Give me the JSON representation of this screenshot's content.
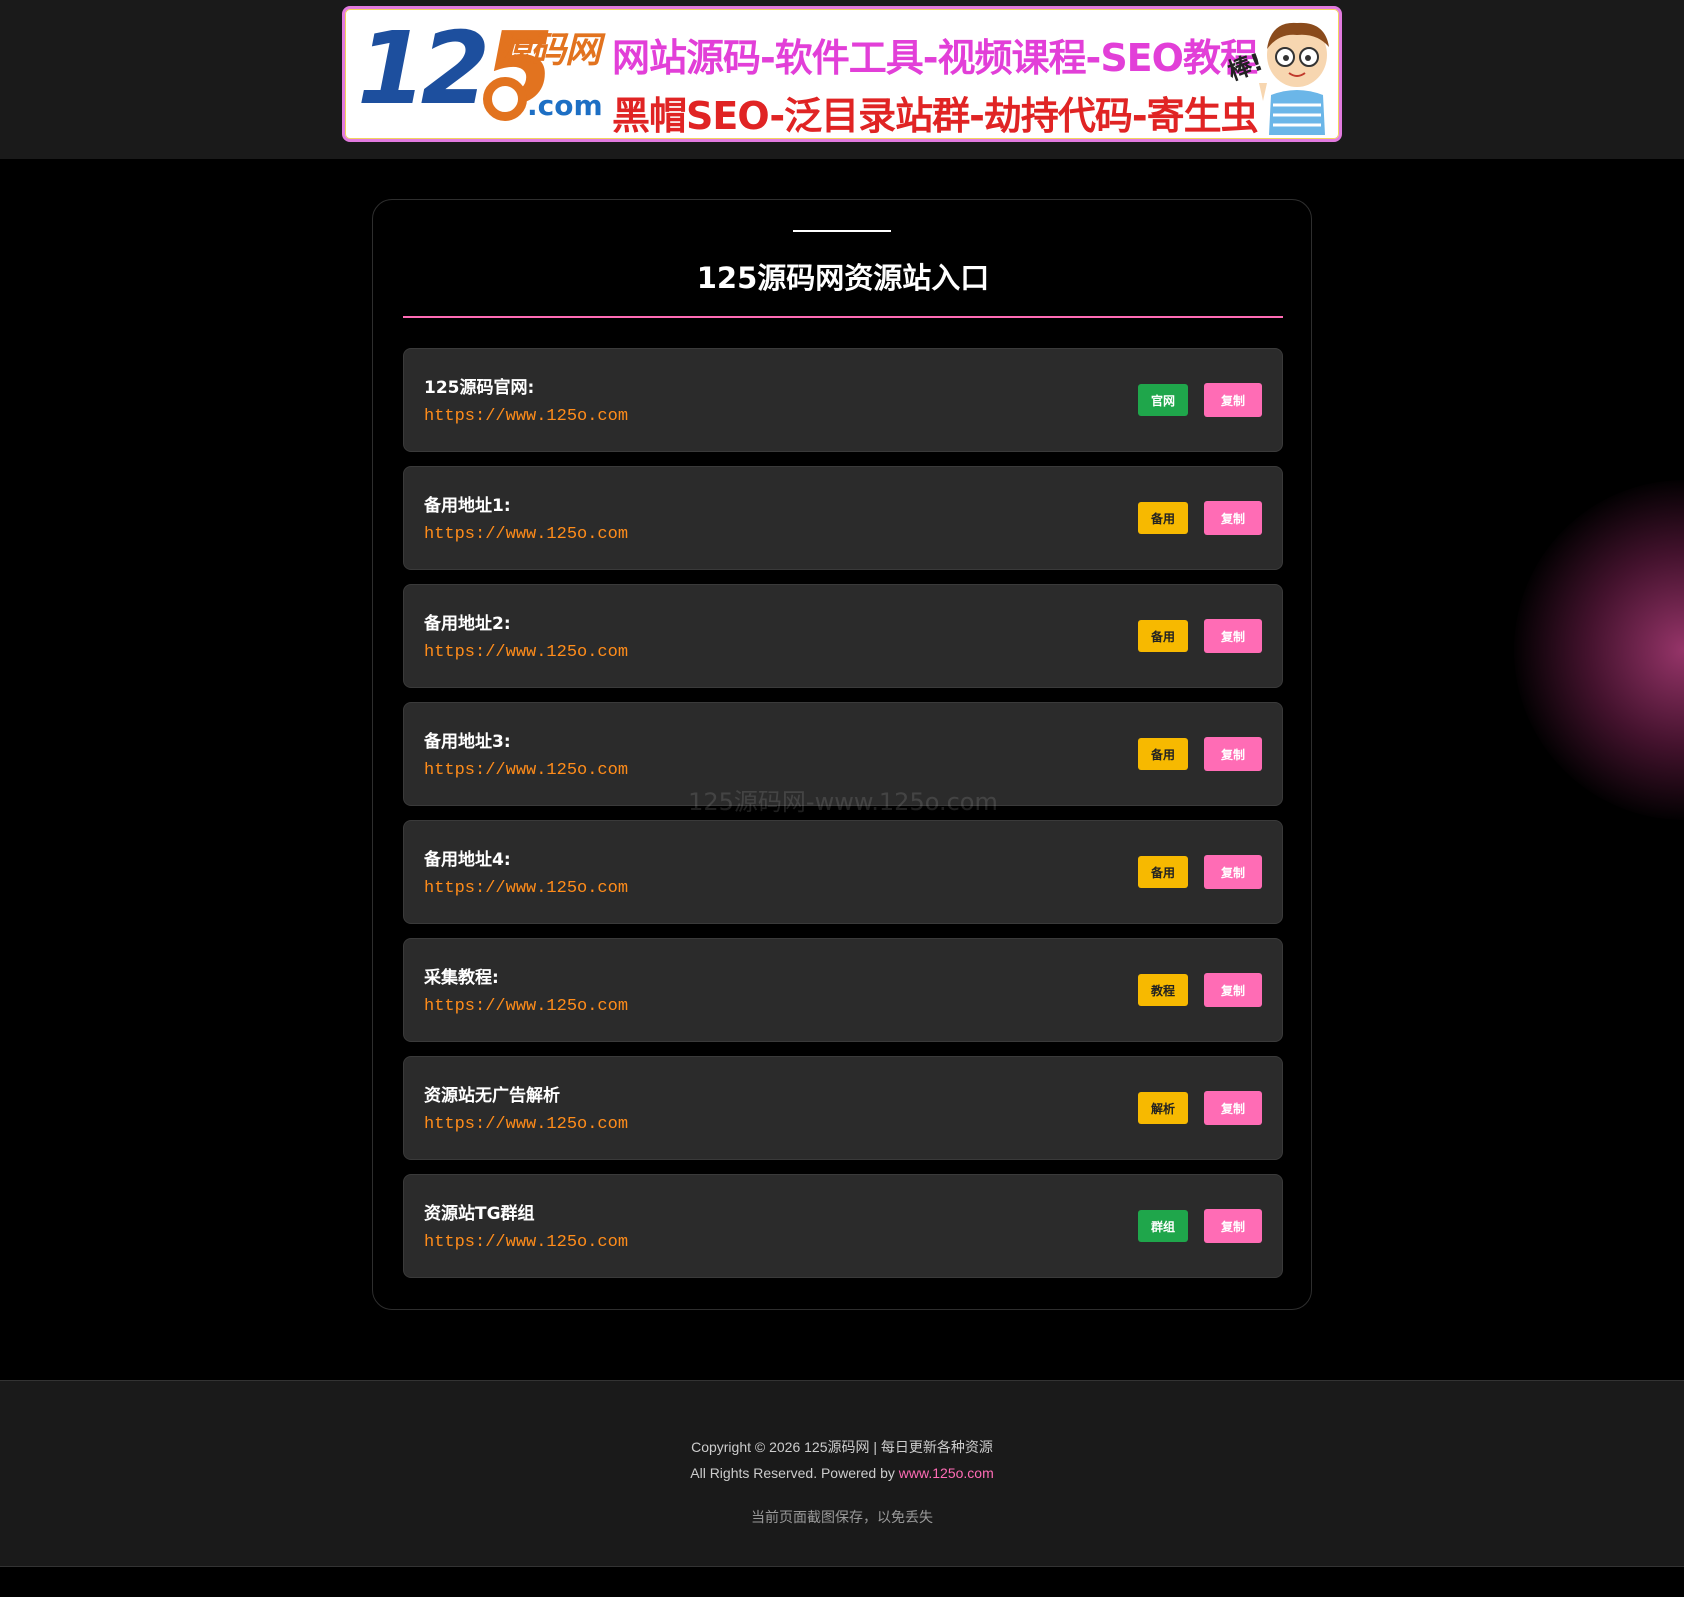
{
  "header": {
    "logo": {
      "number_part1": "12",
      "number_part2": "5",
      "brand": "源码网",
      "dotcom": ".com"
    },
    "slogan_line1": "网站源码-软件工具-视频课程-SEO教程",
    "slogan_line2": "黑帽SEO-泛目录站群-劫持代码-寄生虫",
    "exclaim": "棒!"
  },
  "card": {
    "title": "125源码网资源站入口",
    "watermark": "125源码网-www.125o.com",
    "rows": [
      {
        "label": "125源码官网:",
        "url": "https://www.125o.com",
        "badge": "官网",
        "badge_color": "green",
        "copy": "复制"
      },
      {
        "label": "备用地址1:",
        "url": "https://www.125o.com",
        "badge": "备用",
        "badge_color": "yellow",
        "copy": "复制"
      },
      {
        "label": "备用地址2:",
        "url": "https://www.125o.com",
        "badge": "备用",
        "badge_color": "yellow",
        "copy": "复制"
      },
      {
        "label": "备用地址3:",
        "url": "https://www.125o.com",
        "badge": "备用",
        "badge_color": "yellow",
        "copy": "复制"
      },
      {
        "label": "备用地址4:",
        "url": "https://www.125o.com",
        "badge": "备用",
        "badge_color": "yellow",
        "copy": "复制"
      },
      {
        "label": "采集教程:",
        "url": "https://www.125o.com",
        "badge": "教程",
        "badge_color": "yellow",
        "copy": "复制"
      },
      {
        "label": "资源站无广告解析",
        "url": "https://www.125o.com",
        "badge": "解析",
        "badge_color": "yellow",
        "copy": "复制"
      },
      {
        "label": "资源站TG群组",
        "url": "https://www.125o.com",
        "badge": "群组",
        "badge_color": "green",
        "copy": "复制"
      }
    ]
  },
  "footer": {
    "copyright": "Copyright © 2026 125源码网 | 每日更新各种资源",
    "rights_prefix": "All Rights Reserved. Powered by ",
    "powered_link": "www.125o.com",
    "notice": "当前页面截图保存，以免丢失"
  },
  "colors": {
    "accent_pink": "#ff6cb5",
    "url_orange": "#ff8c1a",
    "badge_green": "#1fa64b",
    "badge_yellow": "#f7b900",
    "row_bg": "#2b2b2b"
  }
}
